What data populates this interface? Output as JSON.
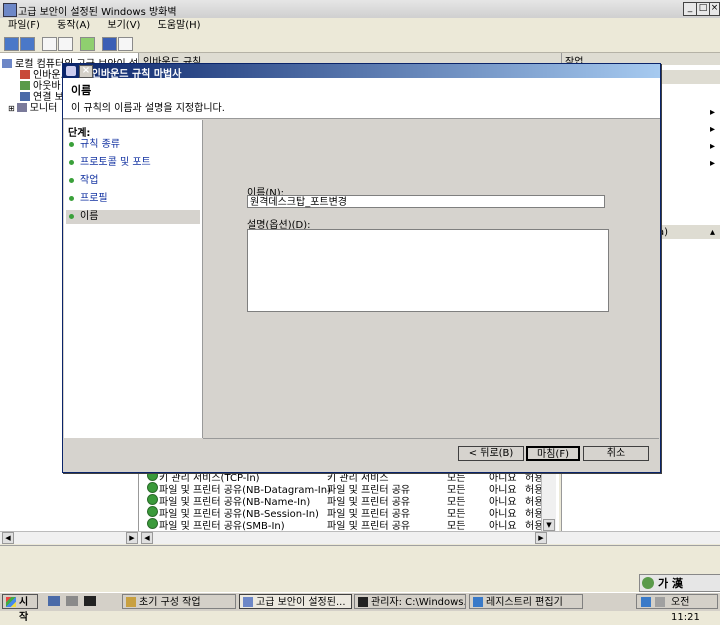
{
  "window": {
    "title": "고급 보안이 설정된 Windows 방화벽"
  },
  "menu": [
    "파일(F)",
    "동작(A)",
    "보기(V)",
    "도움말(H)"
  ],
  "tree": {
    "root": "로컬 컴퓨터의 고급 보안이 설정",
    "items": [
      "인바운드",
      "아웃바",
      "연결 보",
      "모니터"
    ]
  },
  "center": {
    "header": "인바운드 규칙"
  },
  "actions": {
    "header": "작업",
    "partial_item": "a)"
  },
  "list": {
    "rows": [
      {
        "name": "키 관리 서비스(TCP-In)",
        "group": "키 관리 서비스",
        "profile": "모든",
        "enabled": "아니요",
        "action": "허용"
      },
      {
        "name": "파일 및 프린터 공유(NB-Datagram-In)",
        "group": "파일 및 프린터 공유",
        "profile": "모든",
        "enabled": "아니요",
        "action": "허용"
      },
      {
        "name": "파일 및 프린터 공유(NB-Name-In)",
        "group": "파일 및 프린터 공유",
        "profile": "모든",
        "enabled": "아니요",
        "action": "허용"
      },
      {
        "name": "파일 및 프린터 공유(NB-Session-In)",
        "group": "파일 및 프린터 공유",
        "profile": "모든",
        "enabled": "아니요",
        "action": "허용"
      },
      {
        "name": "파일 및 프린터 공유(SMB-In)",
        "group": "파일 및 프린터 공유",
        "profile": "모든",
        "enabled": "아니요",
        "action": "허용"
      }
    ]
  },
  "dialog": {
    "title": "새 인바운드 규칙 마법사",
    "heading": "이름",
    "subheading": "이 규칙의 이름과 설명을 지정합니다.",
    "steps_header": "단계:",
    "steps": [
      "규칙 종류",
      "프로토콜 및 포트",
      "작업",
      "프로필",
      "이름"
    ],
    "name_label": "이름(N):",
    "name_value": "원격데스크탑_포트변경",
    "desc_label": "설명(옵션)(D):",
    "back_button": "< 뒤로(B)",
    "finish_button": "마침(F)",
    "cancel_button": "취소"
  },
  "language_bar": {
    "label": "가 漢"
  },
  "taskbar": {
    "start": "시작",
    "tasks": [
      "초기 구성 작업",
      "고급 보안이 설정된...",
      "관리자: C:\\Windows...",
      "레지스트리 편집기"
    ],
    "clock": "오전 11:21"
  },
  "colors": {
    "dialog_title": "#0a246a",
    "step_link": "#1030a0",
    "step_dot": "#3aa03a"
  }
}
